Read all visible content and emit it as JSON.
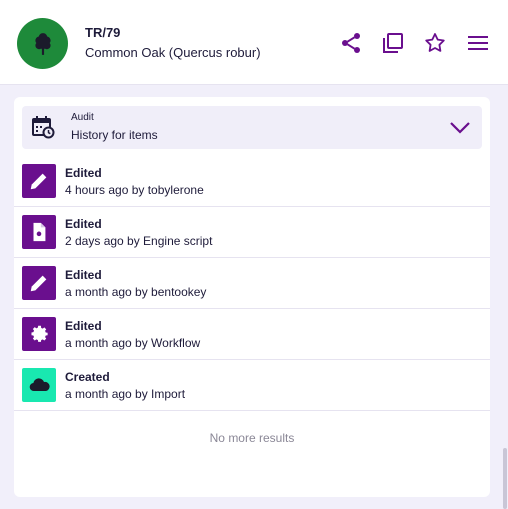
{
  "header": {
    "ref": "TR/79",
    "name": "Common Oak (Quercus robur)",
    "avatar_icon": "tree-icon",
    "avatar_color": "#1e8a3a",
    "actions": [
      "share-icon",
      "copy-icon",
      "star-icon",
      "menu-icon"
    ],
    "accent_color": "#6a0f8e"
  },
  "audit": {
    "title": "Audit",
    "subtitle": "History for items",
    "icon": "calendar-clock-icon",
    "expand_icon": "chevron-down-icon"
  },
  "history": [
    {
      "action": "Edited",
      "detail": "4 hours ago by tobylerone",
      "icon": "pencil-icon",
      "color": "#6a0f8e"
    },
    {
      "action": "Edited",
      "detail": "2 days ago by Engine script",
      "icon": "script-file-icon",
      "color": "#6a0f8e"
    },
    {
      "action": "Edited",
      "detail": "a month ago by bentookey",
      "icon": "pencil-icon",
      "color": "#6a0f8e"
    },
    {
      "action": "Edited",
      "detail": "a month ago by Workflow",
      "icon": "gear-icon",
      "color": "#6a0f8e"
    },
    {
      "action": "Created",
      "detail": "a month ago by Import",
      "icon": "cloud-icon",
      "color": "#19e8b0"
    }
  ],
  "footer": {
    "no_more": "No more results"
  }
}
